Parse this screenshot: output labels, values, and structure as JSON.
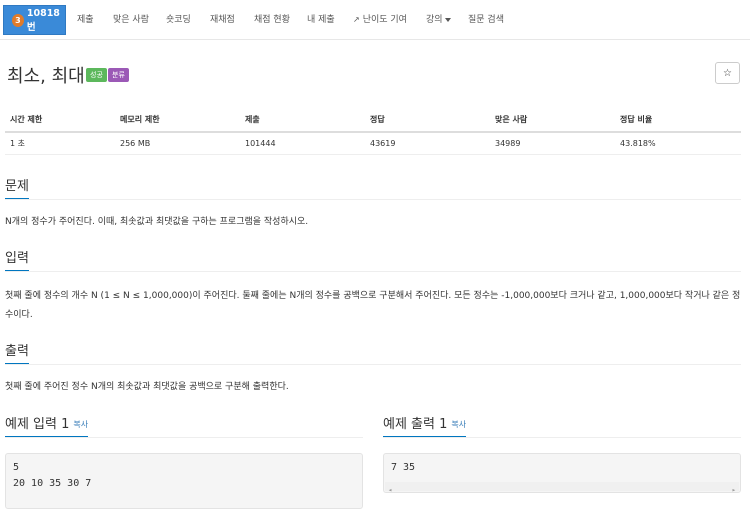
{
  "nav": {
    "brand_badge": "3",
    "brand_label": "10818번",
    "items": [
      "제출",
      "맞은 사람",
      "숏코딩",
      "재채점",
      "채점 현황",
      "내 제출",
      "난이도 기여",
      "강의",
      "질문 검색"
    ]
  },
  "problem": {
    "title": "최소, 최대",
    "label_success": "성공",
    "label_category": "분류",
    "star": "☆"
  },
  "info": {
    "headers": [
      "시간 제한",
      "메모리 제한",
      "제출",
      "정답",
      "맞은 사람",
      "정답 비율"
    ],
    "values": [
      "1 초",
      "256 MB",
      "101444",
      "43619",
      "34989",
      "43.818%"
    ]
  },
  "sections": {
    "desc_title": "문제",
    "desc_text": "N개의 정수가 주어진다. 이때, 최솟값과 최댓값을 구하는 프로그램을 작성하시오.",
    "input_title": "입력",
    "input_text": "첫째 줄에 정수의 개수 N (1 ≤ N ≤ 1,000,000)이 주어진다. 둘째 줄에는 N개의 정수를 공백으로 구분해서 주어진다. 모든 정수는 -1,000,000보다 크거나 같고, 1,000,000보다 작거나 같은 정수이다.",
    "output_title": "출력",
    "output_text": "첫째 줄에 주어진 정수 N개의 최솟값과 최댓값을 공백으로 구분해 출력한다."
  },
  "samples": {
    "input_title": "예제 입력 1",
    "output_title": "예제 출력 1",
    "copy_label": "복사",
    "input_lines": [
      "5",
      "20 10 35 30 7"
    ],
    "output_lines": [
      "7 35"
    ]
  },
  "colors": {
    "brand": "#3a8ad8",
    "success": "#5cb85c",
    "category": "#9b59b6",
    "headline_accent": "#0076c0",
    "link": "#337ab7"
  }
}
